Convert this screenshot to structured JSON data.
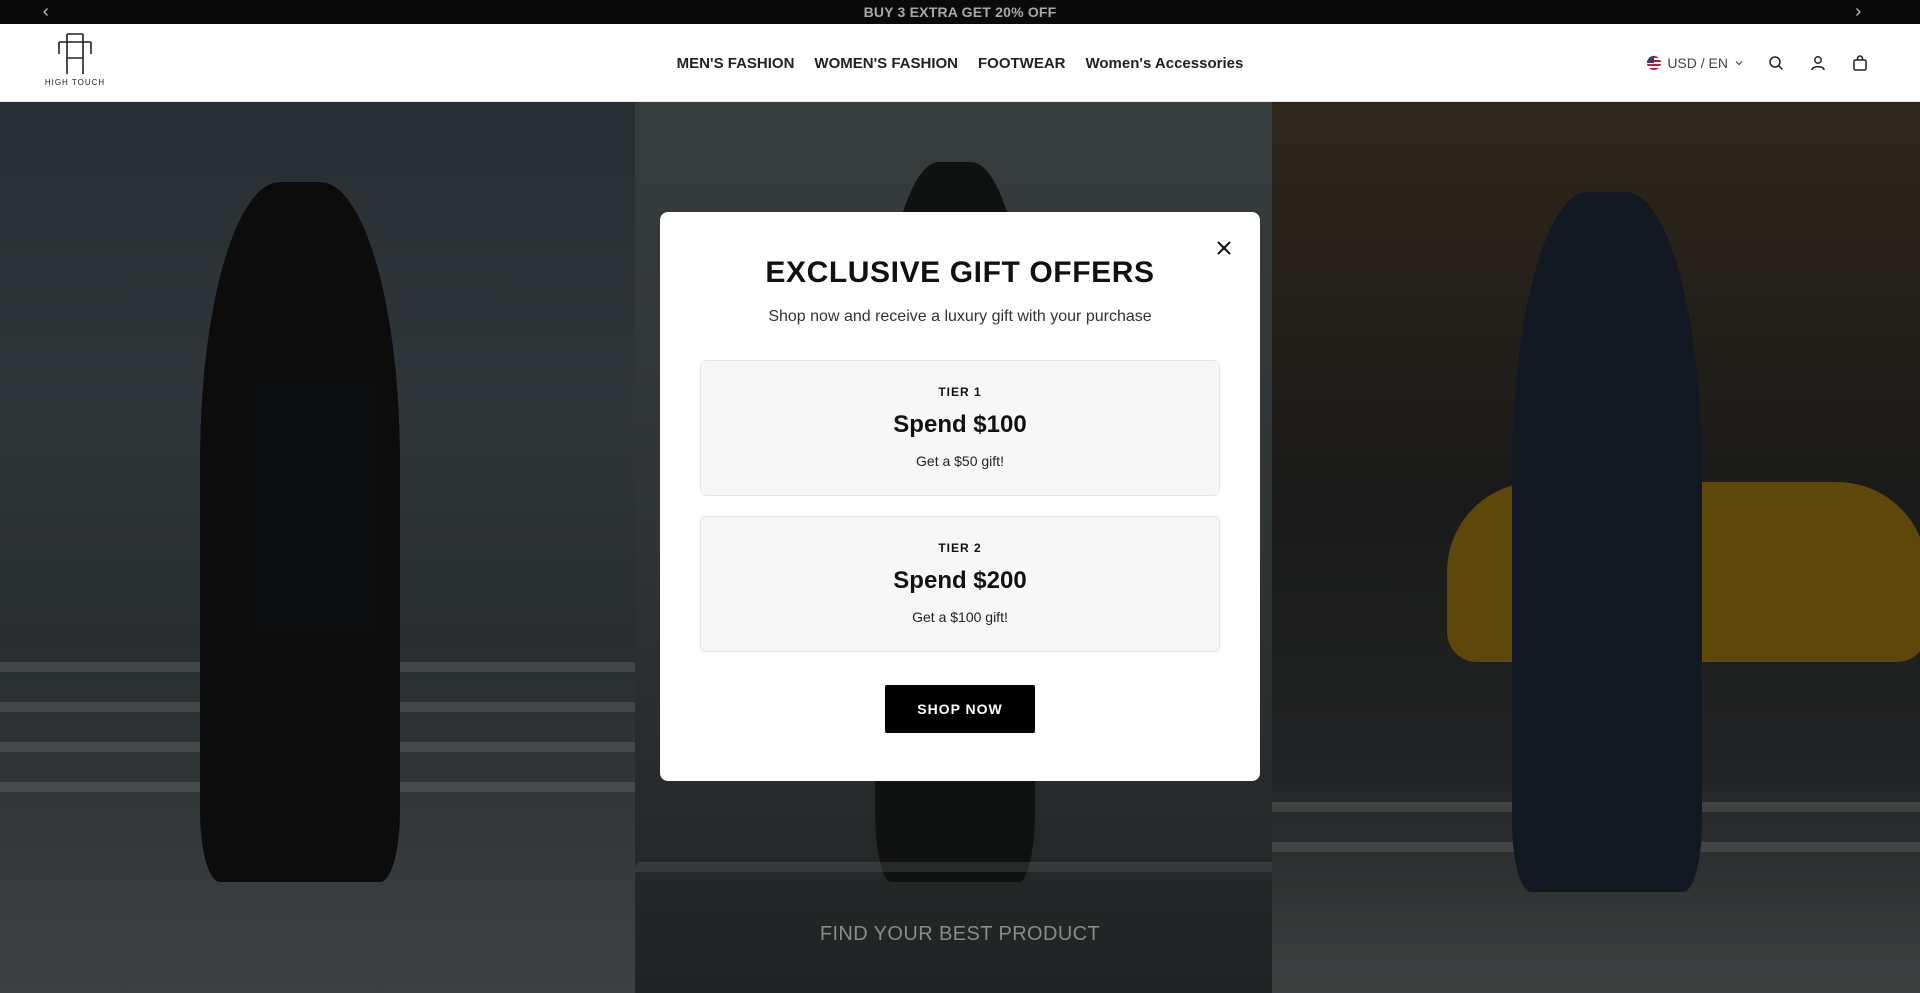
{
  "announcement": {
    "text": "BUY 3 EXTRA GET 20% OFF",
    "prev_icon": "chevron-left-icon",
    "next_icon": "chevron-right-icon"
  },
  "header": {
    "logo_text": "HIGH TOUCH",
    "nav": [
      {
        "label": "MEN'S FASHION"
      },
      {
        "label": "WOMEN'S FASHION"
      },
      {
        "label": "FOOTWEAR"
      },
      {
        "label": "Women's Accessories"
      }
    ],
    "currency": "USD / EN",
    "icons": [
      "search-icon",
      "account-icon",
      "cart-icon"
    ]
  },
  "hero": {
    "caption": "FIND YOUR BEST PRODUCT"
  },
  "modal": {
    "title": "EXCLUSIVE GIFT OFFERS",
    "subtitle": "Shop now and receive a luxury gift with your purchase",
    "tiers": [
      {
        "label": "TIER 1",
        "amount": "Spend $100",
        "desc": "Get a $50 gift!"
      },
      {
        "label": "TIER 2",
        "amount": "Spend $200",
        "desc": "Get a $100 gift!"
      }
    ],
    "cta": "SHOP NOW"
  },
  "colors": {
    "announcement_bg": "#0a0a0a",
    "button_bg": "#000000",
    "overlay": "rgba(0,0,0,0.56)"
  }
}
